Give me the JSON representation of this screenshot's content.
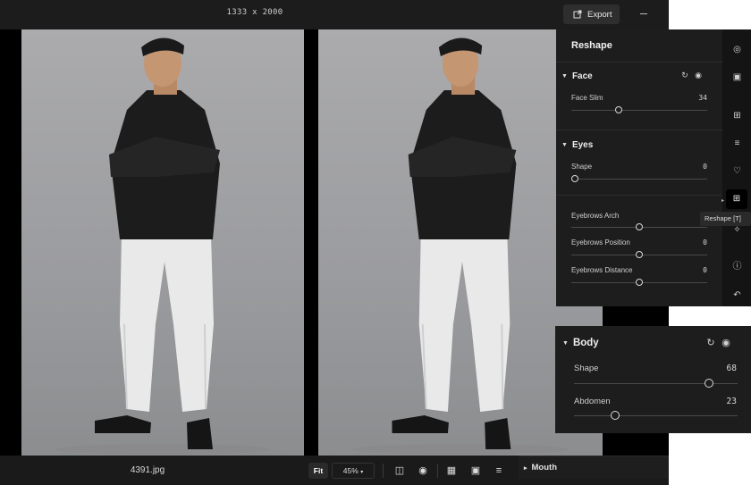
{
  "topbar": {
    "dimensions": "1333 x 2000",
    "export_label": "Export"
  },
  "bottombar": {
    "filename": "4391.jpg",
    "fit_label": "Fit",
    "zoom_label": "45%",
    "mouth_label": "Mouth"
  },
  "panel": {
    "title": "Reshape",
    "face": {
      "title": "Face",
      "face_slim_label": "Face Slim",
      "face_slim_value": "34",
      "face_slim_level": 0.34
    },
    "eyes": {
      "title": "Eyes",
      "shape_label": "Shape",
      "shape_value": "0",
      "shape_level": 0.0,
      "arch_label": "Eyebrows Arch",
      "arch_level": 0.5,
      "position_label": "Eyebrows Position",
      "position_value": "0",
      "position_level": 0.5,
      "distance_label": "Eyebrows Distance",
      "distance_value": "0",
      "distance_level": 0.5
    },
    "tooltip": "Reshape [T]"
  },
  "body_panel": {
    "title": "Body",
    "shape_label": "Shape",
    "shape_value": "68",
    "shape_level": 0.84,
    "abdomen_label": "Abdomen",
    "abdomen_value": "23",
    "abdomen_level": 0.23
  },
  "icons": [
    "export-icon",
    "compare-icon",
    "eye-icon",
    "grid-icon",
    "image-icon",
    "sort-icon",
    "reset-icon",
    "layers-icon",
    "select-icon",
    "crop-icon",
    "sliders-icon",
    "heart-icon",
    "reshape-icon",
    "retouch-icon",
    "info-icon",
    "undo-icon"
  ]
}
